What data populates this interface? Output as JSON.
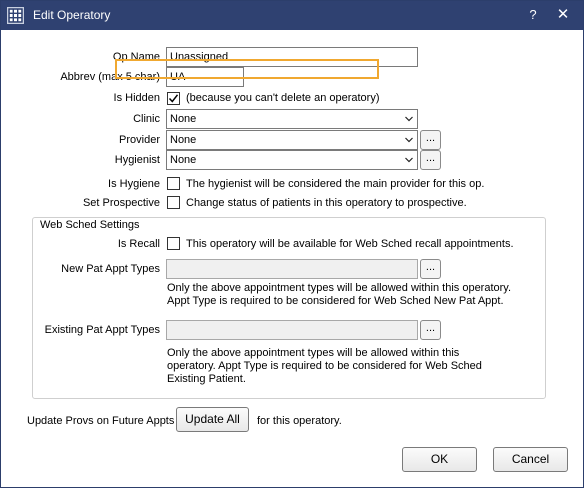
{
  "window": {
    "title": "Edit Operatory",
    "help_label": "?",
    "close_label": "✕"
  },
  "fields": {
    "op_name_label": "Op Name",
    "op_name_value": "Unassigned",
    "abbrev_label": "Abbrev (max 5 char)",
    "abbrev_value": "UA",
    "is_hidden_label": "Is Hidden",
    "is_hidden_checked": true,
    "is_hidden_note": "(because you can't delete an operatory)",
    "clinic_label": "Clinic",
    "clinic_value": "None",
    "provider_label": "Provider",
    "provider_value": "None",
    "hygienist_label": "Hygienist",
    "hygienist_value": "None",
    "browse_label": "...",
    "is_hygiene_label": "Is Hygiene",
    "is_hygiene_note": "The hygienist will be considered the main provider for this op.",
    "set_prospective_label": "Set Prospective",
    "set_prospective_note": "Change status of patients in this operatory to prospective."
  },
  "web_sched": {
    "group_title": "Web Sched Settings",
    "is_recall_label": "Is Recall",
    "is_recall_note": "This operatory will be available for Web Sched recall appointments.",
    "new_pat_label": "New Pat Appt Types",
    "new_pat_value": "",
    "new_pat_note_1": "Only the above appointment types will be allowed within this operatory.",
    "new_pat_note_2": "Appt Type is required to be considered for Web Sched New Pat Appt.",
    "existing_pat_label": "Existing Pat Appt Types",
    "existing_pat_value": "",
    "existing_pat_note_1": "Only the above appointment types will be allowed within this",
    "existing_pat_note_2": "operatory.  Appt Type is required to be considered for Web Sched",
    "existing_pat_note_3": "Existing Patient."
  },
  "footer": {
    "update_provs_label": "Update Provs on Future Appts",
    "update_all_button": "Update All",
    "update_suffix": "for this operatory.",
    "ok_button": "OK",
    "cancel_button": "Cancel"
  },
  "colors": {
    "titlebar": "#2f4171",
    "highlight_border": "#f0a830"
  },
  "icons": {
    "app": "open-dental-grid-icon",
    "dropdown": "chevron-down-icon",
    "check": "checkmark-icon"
  }
}
